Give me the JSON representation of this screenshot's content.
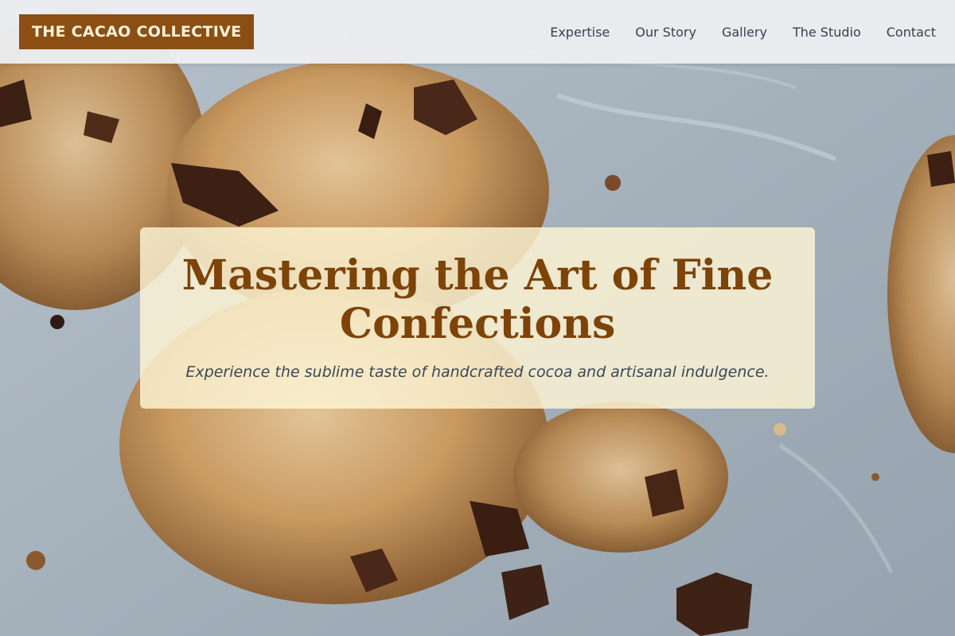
{
  "header": {
    "brand": "THE CACAO COLLECTIVE",
    "brand_color": "#8b4f14",
    "nav": [
      {
        "label": "Expertise"
      },
      {
        "label": "Our Story"
      },
      {
        "label": "Gallery"
      },
      {
        "label": "The Studio"
      },
      {
        "label": "Contact"
      }
    ]
  },
  "hero": {
    "title": "Mastering the Art of Fine Confections",
    "subtitle": "Experience the sublime taste of handcrafted cocoa and artisanal indulgence.",
    "title_color": "#7d4309",
    "background_image": "chocolate-chip-cookies-photo"
  }
}
